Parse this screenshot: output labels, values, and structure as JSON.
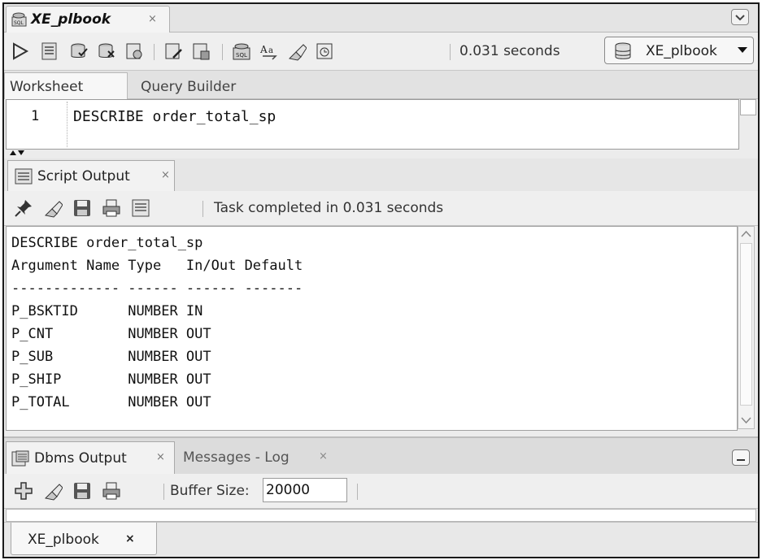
{
  "editor": {
    "tab_title": "XE_plbook",
    "tab_close": "×",
    "toolbar_icons": [
      "run-statement-icon",
      "run-script-icon",
      "commit-icon",
      "rollback-icon",
      "autotrace-icon",
      "explain-plan-icon",
      "tuning-advisor-icon",
      "sql-history-icon",
      "format-icon",
      "clear-icon",
      "sql-worksheet-icon"
    ],
    "execution_time": "0.031 seconds",
    "connection": "XE_plbook"
  },
  "worksheet_tabs": [
    {
      "label": "Worksheet",
      "active": true
    },
    {
      "label": "Query Builder",
      "active": false
    }
  ],
  "code": {
    "line_number": "1",
    "line": "DESCRIBE order_total_sp"
  },
  "script_output": {
    "tab_title": "Script Output",
    "tab_close": "×",
    "status": "Task completed in 0.031 seconds",
    "lines": [
      "DESCRIBE order_total_sp",
      "Argument Name Type   In/Out Default",
      "------------- ------ ------ -------",
      "P_BSKTID      NUMBER IN",
      "P_CNT         NUMBER OUT",
      "P_SUB         NUMBER OUT",
      "P_SHIP        NUMBER OUT",
      "P_TOTAL       NUMBER OUT"
    ]
  },
  "dbms_output": {
    "tab_title": "Dbms Output",
    "tab_close": "×",
    "messages_tab": "Messages - Log",
    "messages_close": "×",
    "buffer_label": "Buffer Size:",
    "buffer_value": "20000"
  },
  "bottom_tab": {
    "label": "XE_plbook",
    "close": "×"
  },
  "colors": {
    "frame_border": "#1a1a1a",
    "panel_background": "#ececec",
    "text": "#222222"
  }
}
